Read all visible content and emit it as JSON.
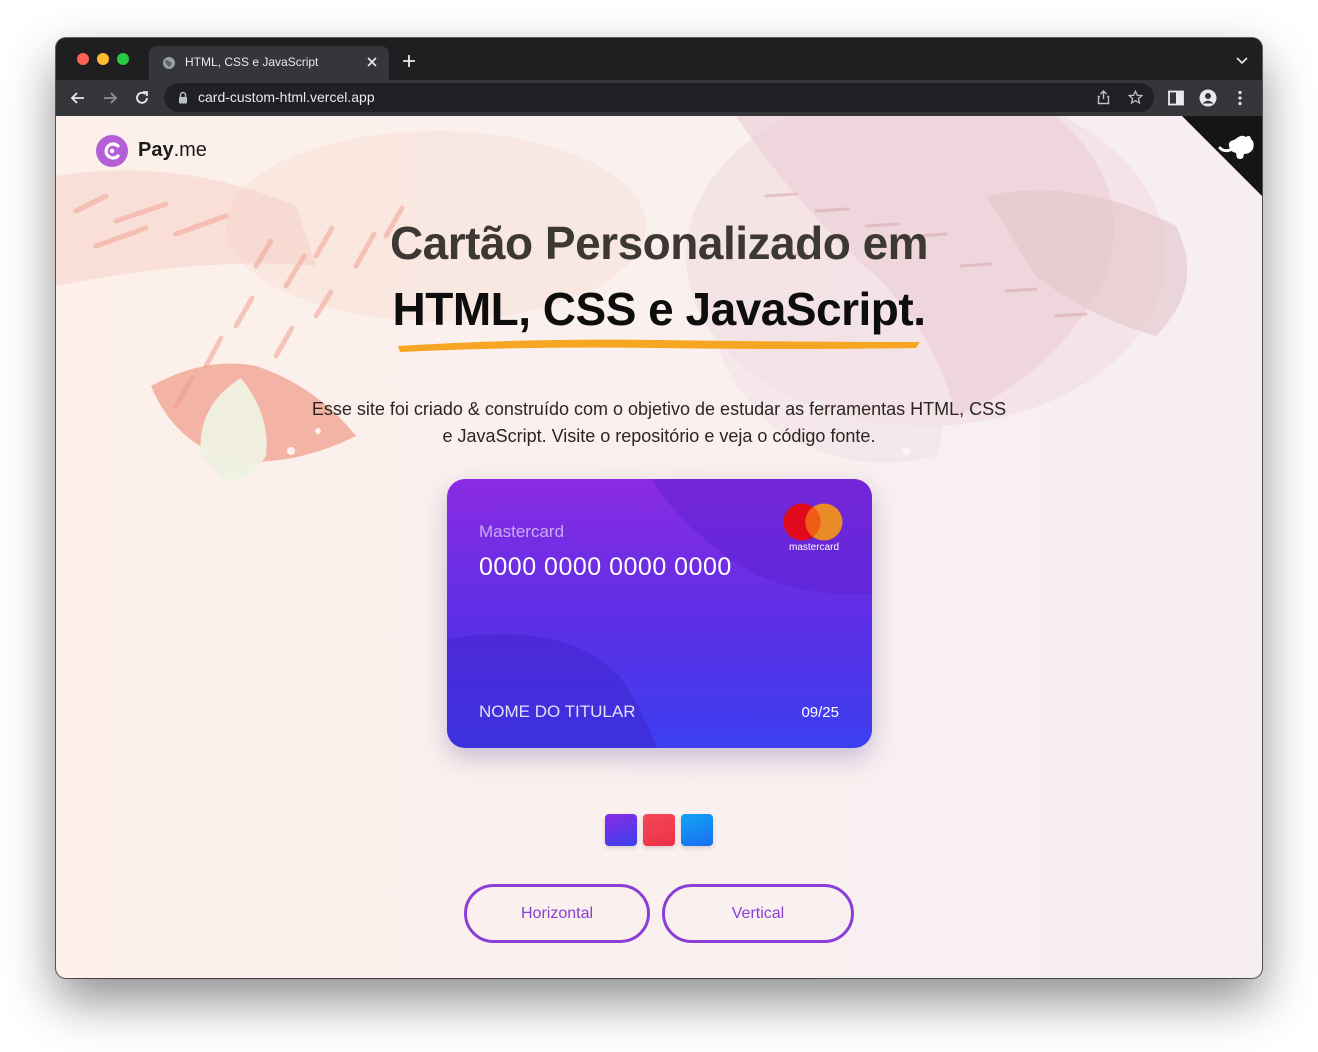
{
  "browser": {
    "tab_title": "HTML, CSS e JavaScript",
    "url": "card-custom-html.vercel.app",
    "icons": [
      "globe-icon",
      "close-icon",
      "plus-icon",
      "chevron-down-icon",
      "back-arrow-icon",
      "forward-arrow-icon",
      "reload-icon",
      "lock-icon",
      "share-icon",
      "star-icon",
      "sidebar-icon",
      "profile-icon",
      "more-vert-icon"
    ]
  },
  "logo": {
    "bold": "Pay",
    "rest": ".me"
  },
  "hero": {
    "line1": "Cartão Personalizado em",
    "line2": "HTML, CSS e JavaScript.",
    "description": "Esse site foi criado & construído com o objetivo de estudar as ferramentas HTML, CSS e JavaScript. Visite o repositório e veja o código fonte."
  },
  "card": {
    "brand": "Mastercard",
    "number": "0000 0000 0000 0000",
    "logo_text": "mastercard",
    "holder": "NOME DO TITULAR",
    "expiry": "09/25"
  },
  "colors": {
    "accent": "#8a3fd6",
    "highlight": "#f6a623",
    "swatches": [
      "#7b2ff7",
      "#f0394f",
      "#1a8cf2"
    ]
  },
  "buttons": {
    "horizontal": "Horizontal",
    "vertical": "Vertical"
  }
}
